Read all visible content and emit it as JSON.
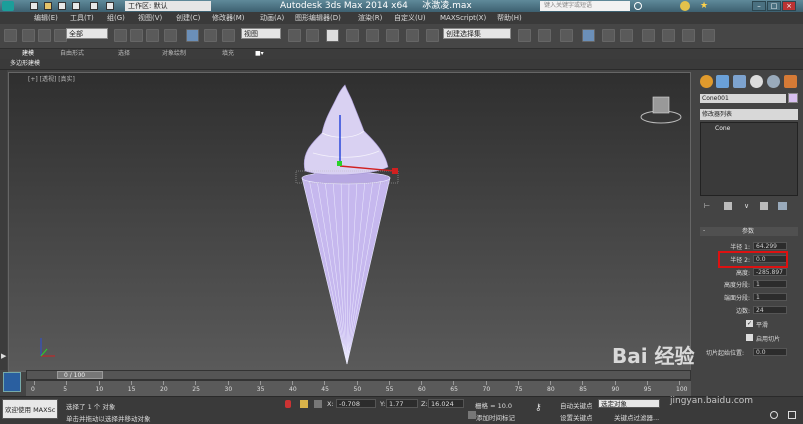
{
  "titlebar": {
    "app_title": "Autodesk 3ds Max  2014 x64",
    "file_name": "冰激凌.max",
    "workspace_label": "工作区: 默认",
    "search_placeholder": "键入关键字或短语"
  },
  "menu": [
    "编辑(E)",
    "工具(T)",
    "组(G)",
    "视图(V)",
    "创建(C)",
    "修改器(M)",
    "动画(A)",
    "图形编辑器(D)",
    "渲染(R)",
    "自定义(U)",
    "MAXScript(X)",
    "帮助(H)"
  ],
  "toolbar": {
    "selection_filter": "全部",
    "view_dropdown": "视图",
    "selection_set": "创建选择集"
  },
  "ribbon": {
    "tabs": [
      "建模",
      "自由形式",
      "选择",
      "对象绘制",
      "填充"
    ],
    "sub_tab": "多边形建模"
  },
  "viewport": {
    "label": "[+] [透视] [真实]"
  },
  "command_panel": {
    "object_name": "Cone001",
    "modifier_list": "修改器列表",
    "stack_item": "Cone",
    "rollout_title": "参数",
    "params": [
      {
        "label": "半径 1:",
        "value": "64.299"
      },
      {
        "label": "半径 2:",
        "value": "0.0"
      },
      {
        "label": "高度:",
        "value": "-285.897"
      },
      {
        "label": "高度分段:",
        "value": "1"
      },
      {
        "label": "端面分段:",
        "value": "1"
      },
      {
        "label": "边数:",
        "value": "24"
      }
    ],
    "smooth_label": "平滑",
    "slice_on_label": "启用切片",
    "slice_from_label": "切片起始位置:",
    "slice_from_value": "0.0"
  },
  "timeline": {
    "frame_display": "0 / 100",
    "ticks": [
      "0",
      "5",
      "10",
      "15",
      "20",
      "25",
      "30",
      "35",
      "40",
      "45",
      "50",
      "55",
      "60",
      "65",
      "70",
      "75",
      "80",
      "85",
      "90",
      "95",
      "100"
    ]
  },
  "status": {
    "welcome": "欢迎使用  MAXSc",
    "selected": "选择了 1 个 对象",
    "prompt": "单击并拖动以选择并移动对象",
    "x_value": "-0.708",
    "y_value": "1.77",
    "z_value": "16.024",
    "grid": "栅格 = 10.0",
    "add_time_tag": "添加时间标记",
    "auto_key": "自动关键点",
    "selected_object": "选定对象",
    "set_key": "设置关键点",
    "key_filters": "关键点过滤器..."
  },
  "watermark": {
    "main": "Bai 经验",
    "sub": "jingyan.baidu.com"
  },
  "colors": {
    "cone_color": "#b9a9e6",
    "highlight_box": "#dd1111"
  }
}
